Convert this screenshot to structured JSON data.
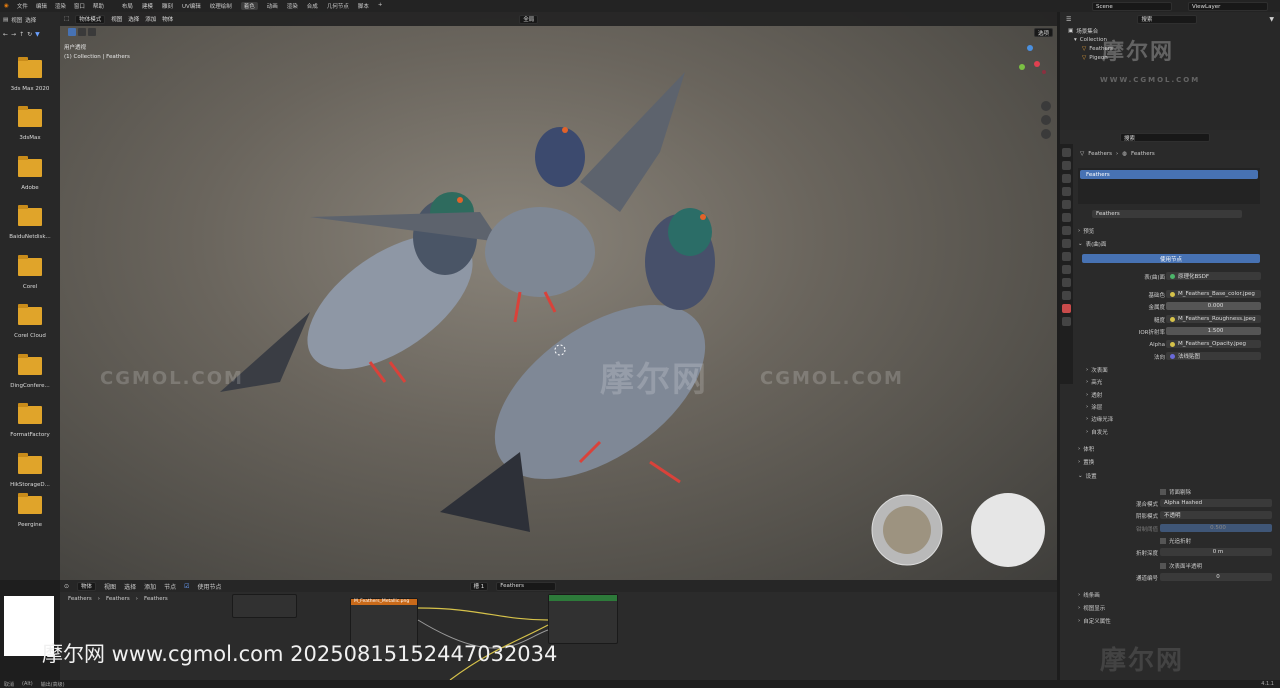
{
  "topbar": {
    "menus": [
      "文件",
      "编辑",
      "渲染",
      "窗口",
      "帮助"
    ],
    "workspaces": [
      "布局",
      "建模",
      "雕刻",
      "UV编辑",
      "纹理绘制",
      "着色",
      "动画",
      "渲染",
      "合成",
      "几何节点",
      "脚本"
    ],
    "active_workspace": "着色",
    "scene": "Scene",
    "view_layer": "ViewLayer"
  },
  "left_panel": {
    "header": [
      "视图",
      "选择"
    ],
    "folders": [
      "3ds Max 2020",
      "3dsMax",
      "Adobe",
      "BaiduNetdisk...",
      "Corel",
      "Corel Cloud",
      "DingConfere...",
      "FormatFactory",
      "HikStorageD...",
      "Peergine"
    ]
  },
  "viewport": {
    "mode": "物体模式",
    "menus": [
      "视图",
      "选择",
      "添加",
      "物体"
    ],
    "global": "全局",
    "options": "选项",
    "info_line1": "用户透视",
    "info_line2": "(1) Collection | Feathers",
    "watermark1": "CGMOL.COM",
    "watermark2": "摩尔网"
  },
  "outliner": {
    "title": "场景集合",
    "search_placeholder": "搜索",
    "items": [
      "Collection",
      "Feathers",
      "Pigeon"
    ],
    "watermark": "摩尔网",
    "watermark_sub": "WWW.CGMOL.COM"
  },
  "properties": {
    "search_placeholder": "搜索",
    "breadcrumb": [
      "Feathers",
      "Feathers"
    ],
    "material_slot": "Feathers",
    "material_name": "Feathers",
    "sections_top": [
      "预览",
      "表(曲)面"
    ],
    "use_nodes": "使用节点",
    "surface_label": "表(曲)面",
    "surface_value": "原理化BSDF",
    "rows": [
      {
        "label": "基础色",
        "value": "M_Feathers_Base_color.jpeg"
      },
      {
        "label": "金属度",
        "value": "0.000"
      },
      {
        "label": "糙度",
        "value": "M_Feathers_Roughness.jpeg"
      },
      {
        "label": "IOR折射率",
        "value": "1.500"
      },
      {
        "label": "Alpha",
        "value": "M_Feathers_Opacity.jpeg"
      },
      {
        "label": "法向",
        "value": "法线贴图"
      }
    ],
    "subsections": [
      "次表面",
      "高光",
      "透射",
      "涂层",
      "边缘光泽",
      "自发光"
    ],
    "sections_mid": [
      "体积",
      "置换",
      "设置"
    ],
    "settings": {
      "backface": "背面剔除",
      "blend_label": "混合模式",
      "blend_value": "Alpha Hashed",
      "shadow_label": "阴影模式",
      "shadow_value": "不透明",
      "clip_label": "钳制阈值",
      "clip_value": "0.500",
      "refraction": "光追折射",
      "refr_depth_label": "折射深度",
      "refr_depth_value": "0 m",
      "sss_translucency": "次表面半透明",
      "pass_label": "通道编号",
      "pass_value": "0"
    },
    "sections_bottom": [
      "线条画",
      "视图显示",
      "自定义属性"
    ]
  },
  "node_editor": {
    "menus": [
      "物体",
      "视图",
      "选择",
      "添加",
      "节点"
    ],
    "use_nodes": "使用节点",
    "slot": "槽 1",
    "material": "Feathers",
    "breadcrumb": [
      "Feathers",
      "Feathers",
      "Feathers"
    ],
    "node_title": "M_Feathers_Metallic.png"
  },
  "overlay": {
    "watermark_url": "摩尔网 www.cgmol.com 20250815152447032034"
  },
  "statusbar": {
    "items": [
      "取消",
      "(Alt)",
      "输出(高级)"
    ],
    "version": "4.1.1"
  }
}
